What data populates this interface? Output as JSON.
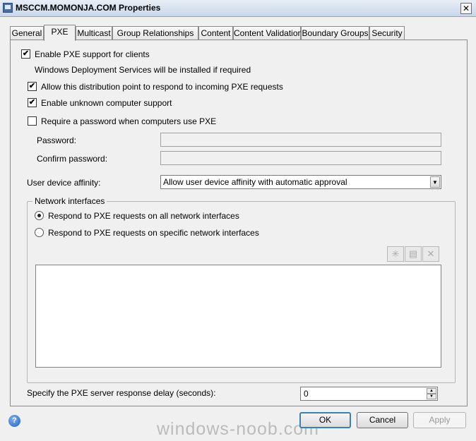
{
  "window": {
    "title": "MSCCM.MOMONJA.COM Properties",
    "close_glyph": "✕"
  },
  "tabs": [
    {
      "label": "General"
    },
    {
      "label": "PXE"
    },
    {
      "label": "Multicast"
    },
    {
      "label": "Group Relationships"
    },
    {
      "label": "Content"
    },
    {
      "label": "Content Validation"
    },
    {
      "label": "Boundary Groups"
    },
    {
      "label": "Security"
    }
  ],
  "active_tab": "PXE",
  "pxe": {
    "enable_pxe": {
      "label": "Enable PXE support for clients",
      "checked": true,
      "mark": "✔"
    },
    "wds_note": "Windows Deployment Services will be installed if required",
    "allow_respond": {
      "label": "Allow this distribution point to respond to incoming PXE requests",
      "checked": true,
      "mark": "✔"
    },
    "unknown_support": {
      "label": "Enable unknown computer support",
      "checked": true,
      "mark": "✔"
    },
    "require_password": {
      "label": "Require a password when computers use PXE",
      "checked": false,
      "mark": ""
    },
    "password_label": "Password:",
    "password_value": "",
    "confirm_label": "Confirm password:",
    "confirm_value": "",
    "affinity_label": "User device affinity:",
    "affinity_value": "Allow user device affinity with automatic approval",
    "network_group_label": "Network interfaces",
    "radio_all": {
      "label": "Respond to PXE requests on all network interfaces",
      "selected": true
    },
    "radio_specific": {
      "label": "Respond to PXE requests on specific network interfaces",
      "selected": false
    },
    "list_buttons": {
      "add_icon": "✳",
      "properties_icon": "▤",
      "delete_icon": "✕"
    },
    "delay_label": "Specify the PXE server response delay (seconds):",
    "delay_value": "0"
  },
  "footer": {
    "ok": "OK",
    "cancel": "Cancel",
    "apply": "Apply",
    "help_glyph": "?",
    "watermark": "windows-noob.com"
  },
  "colors": {
    "dialog_bg": "#f0f0f0",
    "title_gradient_top": "#e8eef6",
    "title_gradient_bottom": "#c9d8ea",
    "default_button_border": "#3c7fb1"
  }
}
